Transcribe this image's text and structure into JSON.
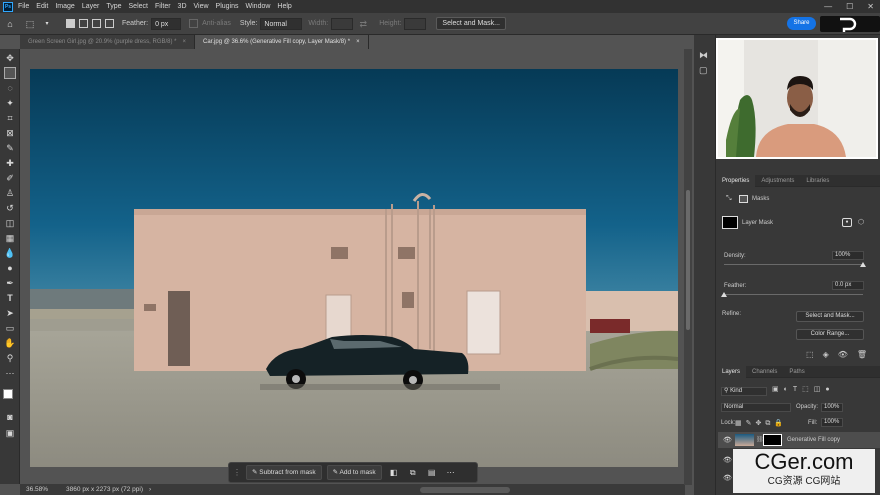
{
  "app": {
    "logo": "Ps"
  },
  "menu": [
    "File",
    "Edit",
    "Image",
    "Layer",
    "Type",
    "Select",
    "Filter",
    "3D",
    "View",
    "Plugins",
    "Window",
    "Help"
  ],
  "window_controls": {
    "minimize": "—",
    "maximize": "☐",
    "close": "✕"
  },
  "options": {
    "feather_label": "Feather:",
    "feather_value": "0 px",
    "anti_alias": "Anti-alias",
    "style_label": "Style:",
    "style_value": "Normal",
    "width_label": "Width:",
    "height_label": "Height:",
    "select_mask": "Select and Mask...",
    "share": "Share"
  },
  "tabs": [
    {
      "title": "Green Screen Girl.jpg @ 20.9% (purple dress, RGB/8) *",
      "close": "×"
    },
    {
      "title": "Car.jpg @ 36.6% (Generative Fill copy, Layer Mask/8) *",
      "close": "×"
    }
  ],
  "context_bar": {
    "subtract": "Subtract from mask",
    "add": "Add to mask"
  },
  "status": {
    "zoom": "36.58%",
    "info": "3860 px x 2273 px (72 ppi)"
  },
  "properties": {
    "tabs": [
      "Properties",
      "Adjustments",
      "Libraries"
    ],
    "section": "Masks",
    "layer_mask": "Layer Mask",
    "density_label": "Density:",
    "density_value": "100%",
    "density": 1.0,
    "feather_label": "Feather:",
    "feather_value": "0.0 px",
    "feather": 0.0,
    "refine_label": "Refine:",
    "select_mask": "Select and Mask...",
    "color_range": "Color Range..."
  },
  "layers": {
    "tabs": [
      "Layers",
      "Channels",
      "Paths"
    ],
    "kind": "Kind",
    "blend": "Normal",
    "opacity_label": "Opacity:",
    "opacity_value": "100%",
    "lock_label": "Lock:",
    "fill_label": "Fill:",
    "fill_value": "100%",
    "rows": [
      {
        "name": "Generative Fill copy"
      }
    ]
  },
  "watermark": {
    "main": "CGer.com",
    "sub": "CG资源 CG网站"
  },
  "colors": {
    "accent": "#1473e6",
    "panel": "#383838",
    "canvas_bg": "#535353"
  }
}
